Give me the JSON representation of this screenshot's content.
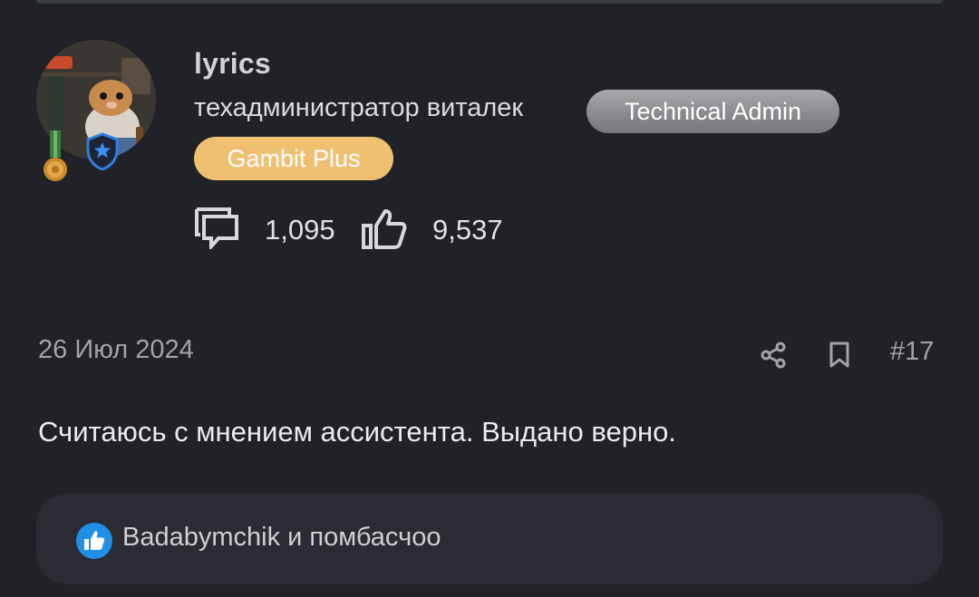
{
  "user": {
    "username": "lyrics",
    "title": "техадминистратор виталек",
    "badges": {
      "technical_admin": "Technical Admin",
      "gambit_plus": "Gambit Plus"
    },
    "icons": [
      "avatar",
      "medal-icon",
      "shield-star-icon"
    ]
  },
  "stats": {
    "messages_icon": "chat-bubble-icon",
    "messages": "1,095",
    "likes_icon": "thumbs-up-icon",
    "likes": "9,537"
  },
  "post": {
    "date": "26 Июл 2024",
    "number": "#17",
    "text": "Считаюсь с мнением ассистента. Выдано верно.",
    "actions": [
      "share-icon",
      "bookmark-icon"
    ]
  },
  "reactions": {
    "icon": "like-reaction-icon",
    "text": "Badabymchik и помбасчоо"
  },
  "colors": {
    "background": "#212228",
    "reactions_bg": "#2b2c33",
    "gambit_badge": "#f0c072",
    "tech_badge": "#8b8b8f",
    "like_blue": "#1f8fe8",
    "shield_blue": "#2f7fe0"
  }
}
